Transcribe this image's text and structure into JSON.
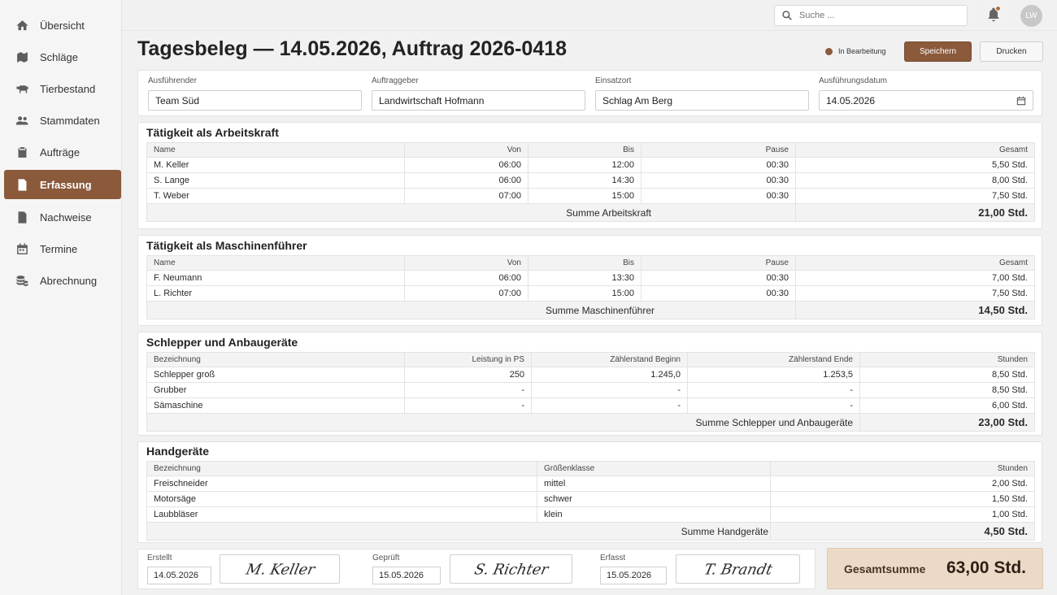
{
  "sidebar": {
    "items": [
      {
        "label": "Übersicht",
        "icon": "home-icon"
      },
      {
        "label": "Schläge",
        "icon": "map-icon"
      },
      {
        "label": "Tierbestand",
        "icon": "cow-icon"
      },
      {
        "label": "Stammdaten",
        "icon": "users-icon"
      },
      {
        "label": "Aufträge",
        "icon": "clipboard-icon"
      },
      {
        "label": "Erfassung",
        "icon": "document-icon",
        "active": true
      },
      {
        "label": "Nachweise",
        "icon": "file-icon"
      },
      {
        "label": "Termine",
        "icon": "calendar-icon"
      },
      {
        "label": "Abrechnung",
        "icon": "coins-icon"
      }
    ]
  },
  "topbar": {
    "search_placeholder": "Suche ...",
    "avatar_initials": "LW"
  },
  "header": {
    "title": "Tagesbeleg — 14.05.2026, Auftrag 2026-0418",
    "status": "In Bearbeitung",
    "save_label": "Speichern",
    "print_label": "Drucken"
  },
  "info": {
    "executor_label": "Ausführender",
    "executor_value": "Team Süd",
    "client_label": "Auftraggeber",
    "client_value": "Landwirtschaft Hofmann",
    "location_label": "Einsatzort",
    "location_value": "Schlag Am Berg",
    "date_label": "Ausführungsdatum",
    "date_value": "14.05.2026"
  },
  "labor": {
    "title": "Tätigkeit als Arbeitskraft",
    "headers": [
      "Name",
      "Von",
      "Bis",
      "Pause",
      "Gesamt"
    ],
    "rows": [
      {
        "name": "M. Keller",
        "von": "06:00",
        "bis": "12:00",
        "pause": "00:30",
        "gesamt": "5,50  Std."
      },
      {
        "name": "S. Lange",
        "von": "06:00",
        "bis": "14:30",
        "pause": "00:30",
        "gesamt": "8,00  Std."
      },
      {
        "name": "T. Weber",
        "von": "07:00",
        "bis": "15:00",
        "pause": "00:30",
        "gesamt": "7,50  Std."
      }
    ],
    "sum_label": "Summe Arbeitskraft",
    "sum_value": "21,00  Std."
  },
  "operators": {
    "title": "Tätigkeit als Maschinenführer",
    "headers": [
      "Name",
      "Von",
      "Bis",
      "Pause",
      "Gesamt"
    ],
    "rows": [
      {
        "name": "F. Neumann",
        "von": "06:00",
        "bis": "13:30",
        "pause": "00:30",
        "gesamt": "7,00  Std."
      },
      {
        "name": "L. Richter",
        "von": "07:00",
        "bis": "15:00",
        "pause": "00:30",
        "gesamt": "7,50  Std."
      }
    ],
    "sum_label": "Summe Maschinenführer",
    "sum_value": "14,50  Std."
  },
  "tractors": {
    "title": "Schlepper und Anbaugeräte",
    "headers": [
      "Bezeichnung",
      "Leistung in PS",
      "Zählerstand Beginn",
      "Zählerstand Ende",
      "Stunden"
    ],
    "rows": [
      {
        "name": "Schlepper groß",
        "ps": "250",
        "start": "1.245,0",
        "end": "1.253,5",
        "hours": "8,50  Std."
      },
      {
        "name": "Grubber",
        "ps": "-",
        "start": "-",
        "end": "-",
        "hours": "8,50  Std."
      },
      {
        "name": "Sämaschine",
        "ps": "-",
        "start": "-",
        "end": "-",
        "hours": "6,00  Std."
      }
    ],
    "sum_label": "Summe Schlepper und Anbaugeräte",
    "sum_value": "23,00  Std."
  },
  "handtools": {
    "title": "Handgeräte",
    "headers": [
      "Bezeichnung",
      "Größenklasse",
      "Stunden"
    ],
    "rows": [
      {
        "name": "Freischneider",
        "size": "mittel",
        "hours": "2,00  Std."
      },
      {
        "name": "Motorsäge",
        "size": "schwer",
        "hours": "1,50  Std."
      },
      {
        "name": "Laubbläser",
        "size": "klein",
        "hours": "1,00  Std."
      }
    ],
    "sum_label": "Summe Handgeräte",
    "sum_value": "4,50  Std."
  },
  "signatures": {
    "created_label": "Erstellt",
    "created_date": "14.05.2026",
    "created_signature": "M. Keller",
    "checked_label": "Geprüft",
    "checked_date": "15.05.2026",
    "checked_signature": "S. Richter",
    "recorded_label": "Erfasst",
    "recorded_date": "15.05.2026",
    "recorded_signature": "T. Brandt"
  },
  "total": {
    "label": "Gesamtsumme",
    "value": "63,00 Std."
  },
  "colors": {
    "accent": "#8a5a3b",
    "total_bg": "#ecd9c6"
  }
}
